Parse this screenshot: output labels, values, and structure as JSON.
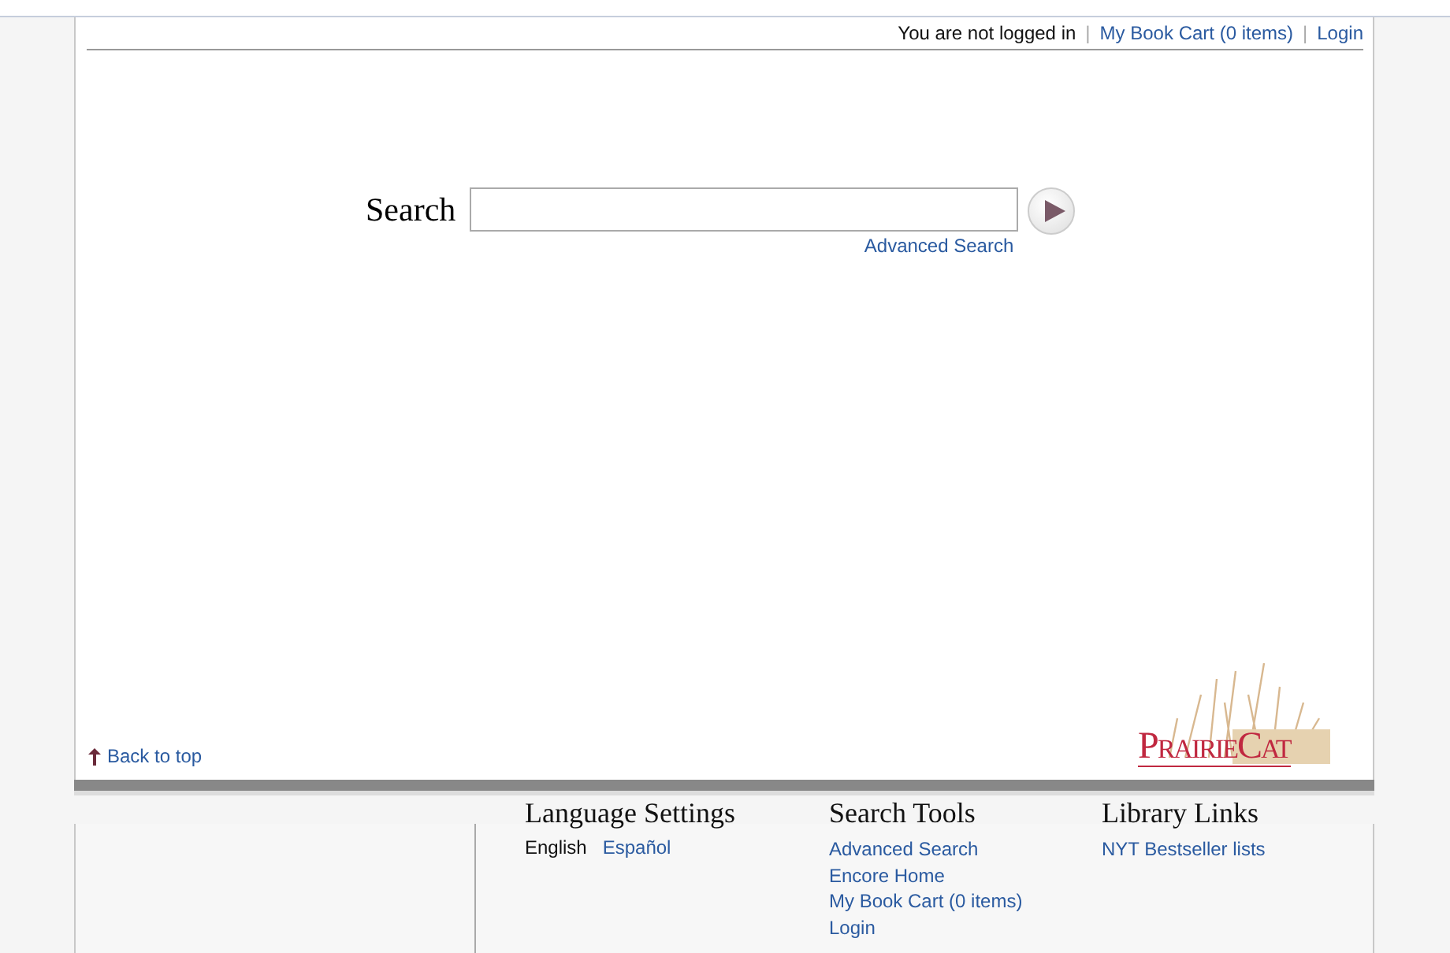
{
  "top_bar": {
    "status": "You are not logged in",
    "links": [
      {
        "label": "My Book Cart (0 items)"
      },
      {
        "label": "Login"
      }
    ],
    "separator": "|"
  },
  "search": {
    "label": "Search",
    "advanced_link": "Advanced Search"
  },
  "back_to_top": "Back to top",
  "logo": {
    "text": "PrairieCat"
  },
  "footer": {
    "columns": [
      {
        "heading": "Language Settings",
        "kind": "languages",
        "items": [
          {
            "label": "English",
            "selected": true
          },
          {
            "label": "Español",
            "selected": false
          }
        ]
      },
      {
        "heading": "Search Tools",
        "kind": "links",
        "items": [
          {
            "label": "Advanced Search"
          },
          {
            "label": "Encore Home"
          },
          {
            "label": "My Book Cart (0 items)"
          },
          {
            "label": "Login"
          }
        ]
      },
      {
        "heading": "Library Links",
        "kind": "links",
        "items": [
          {
            "label": "NYT Bestseller lists"
          }
        ]
      }
    ]
  }
}
